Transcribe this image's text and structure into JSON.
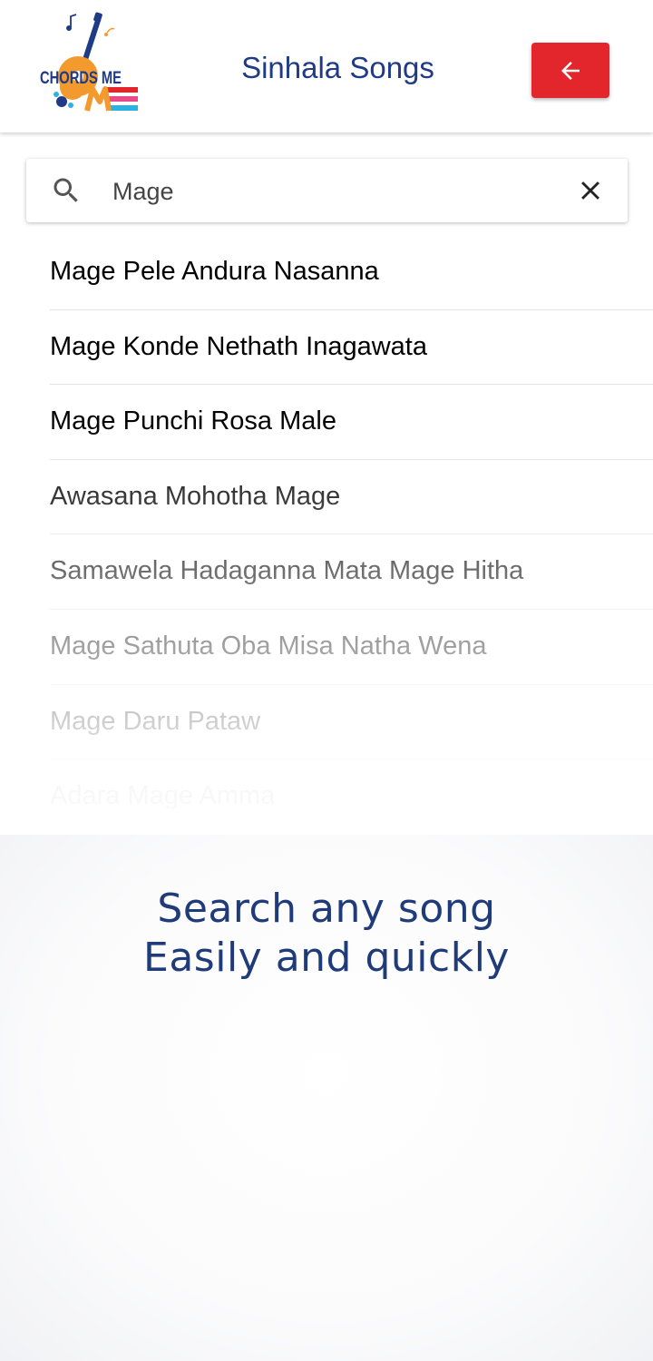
{
  "header": {
    "logo_text": "CHORDS ME",
    "title": "Sinhala Songs",
    "back_button_icon": "arrow-left-icon",
    "accent_color": "#e2262b",
    "title_color": "#1f3b86"
  },
  "search": {
    "value": "Mage",
    "icon": "search-icon",
    "clear_icon": "close-icon"
  },
  "results": [
    "Mage Pele Andura Nasanna",
    "Mage Konde Nethath Inagawata",
    "Mage Punchi Rosa Male",
    "Awasana Mohotha Mage",
    "Samawela Hadaganna Mata Mage Hitha",
    "Mage Sathuta Oba Misa Natha Wena",
    "Mage Daru Pataw",
    "Adara Mage Amma"
  ],
  "promo": {
    "line1": "Search any song",
    "line2": "Easily and quickly"
  }
}
